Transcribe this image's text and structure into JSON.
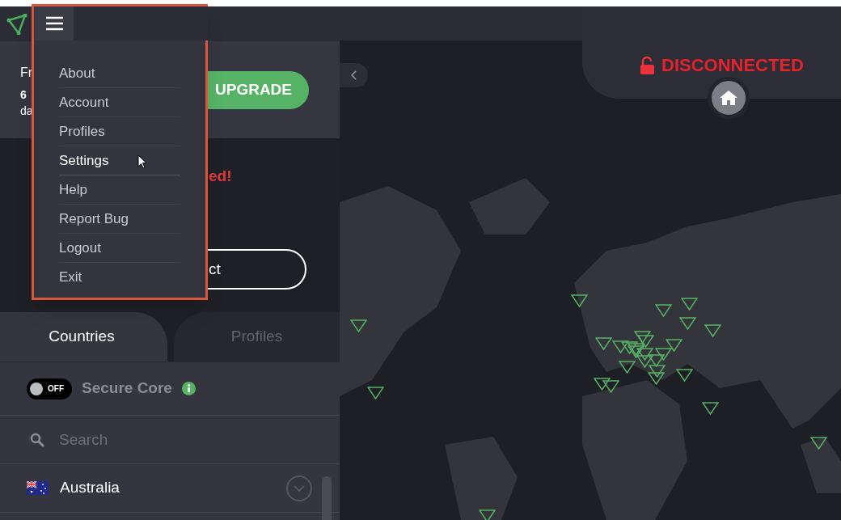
{
  "header": {
    "plan_text": "Fr",
    "days_count": "6",
    "days_text": "da",
    "upgrade_button": "UPGRADE"
  },
  "warning_text": "ed!",
  "connect_button": "ct",
  "menu": {
    "items": [
      {
        "label": "About",
        "hovered": false
      },
      {
        "label": "Account",
        "hovered": false
      },
      {
        "label": "Profiles",
        "hovered": false
      },
      {
        "label": "Settings",
        "hovered": true
      },
      {
        "label": "Help",
        "hovered": false
      },
      {
        "label": "Report Bug",
        "hovered": false
      },
      {
        "label": "Logout",
        "hovered": false
      },
      {
        "label": "Exit",
        "hovered": false
      }
    ]
  },
  "tabs": [
    {
      "label": "Countries",
      "selected": true
    },
    {
      "label": "Profiles",
      "selected": false
    }
  ],
  "secure_core": {
    "label": "Secure Core",
    "toggle_text": "OFF",
    "on": false
  },
  "search": {
    "placeholder": "Search"
  },
  "countries": [
    {
      "name": "Australia"
    }
  ],
  "status": {
    "text": "DISCONNECTED"
  }
}
